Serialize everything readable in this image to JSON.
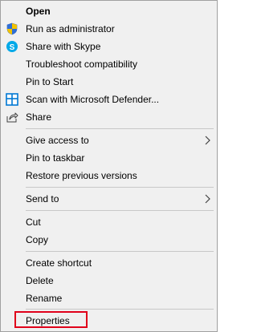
{
  "menu": {
    "open": "Open",
    "run_as_admin": "Run as administrator",
    "share_with_skype": "Share with Skype",
    "troubleshoot": "Troubleshoot compatibility",
    "pin_to_start": "Pin to Start",
    "scan_defender": "Scan with Microsoft Defender...",
    "share": "Share",
    "give_access_to": "Give access to",
    "pin_to_taskbar": "Pin to taskbar",
    "restore_previous": "Restore previous versions",
    "send_to": "Send to",
    "cut": "Cut",
    "copy": "Copy",
    "create_shortcut": "Create shortcut",
    "delete": "Delete",
    "rename": "Rename",
    "properties": "Properties"
  },
  "icons": {
    "run_as_admin": "shield-icon",
    "share_with_skype": "skype-icon",
    "scan_defender": "defender-icon",
    "share": "share-icon",
    "submenu": "chevron-right-icon"
  },
  "colors": {
    "highlight_border": "#e0001a",
    "skype_blue": "#00a9e8",
    "defender_blue": "#0078d4"
  }
}
